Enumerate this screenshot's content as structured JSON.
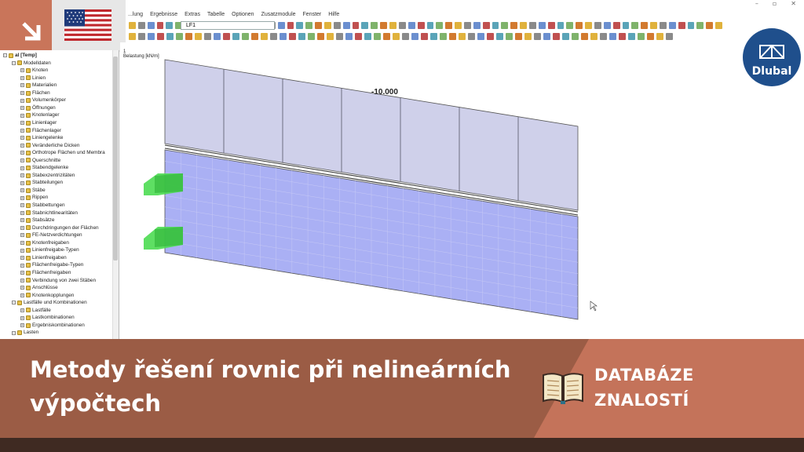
{
  "app": {
    "menu": [
      "...lung",
      "Ergebnisse",
      "Extras",
      "Tabelle",
      "Optionen",
      "Zusatzmodule",
      "Fenster",
      "Hilfe"
    ],
    "window_controls": [
      "–",
      "▫",
      "✕"
    ],
    "load_case": "LF1"
  },
  "navigator": {
    "items": [
      {
        "label": "al [Temp]",
        "level": 0,
        "bold": true
      },
      {
        "label": "Modelldaten",
        "level": 1
      },
      {
        "label": "Knoten",
        "level": 2
      },
      {
        "label": "Linien",
        "level": 2
      },
      {
        "label": "Materialien",
        "level": 2
      },
      {
        "label": "Flächen",
        "level": 2
      },
      {
        "label": "Volumenkörper",
        "level": 2
      },
      {
        "label": "Öffnungen",
        "level": 2
      },
      {
        "label": "Knotenlager",
        "level": 2
      },
      {
        "label": "Linienlager",
        "level": 2
      },
      {
        "label": "Flächenlager",
        "level": 2
      },
      {
        "label": "Liniengelenke",
        "level": 2
      },
      {
        "label": "Veränderliche Dicken",
        "level": 2
      },
      {
        "label": "Orthotrope Flächen und Membra",
        "level": 2
      },
      {
        "label": "Querschnitte",
        "level": 2
      },
      {
        "label": "Stabendgelenke",
        "level": 2
      },
      {
        "label": "Stabexzentrizitäten",
        "level": 2
      },
      {
        "label": "Stabteilungen",
        "level": 2
      },
      {
        "label": "Stäbe",
        "level": 2
      },
      {
        "label": "Rippen",
        "level": 2
      },
      {
        "label": "Stabbettungen",
        "level": 2
      },
      {
        "label": "Stabnichtlinearitäten",
        "level": 2
      },
      {
        "label": "Stabsätze",
        "level": 2
      },
      {
        "label": "Durchdringungen der Flächen",
        "level": 2
      },
      {
        "label": "FE-Netzverdichtungen",
        "level": 2
      },
      {
        "label": "Knotenfreigaben",
        "level": 2
      },
      {
        "label": "Linienfreigabe-Typen",
        "level": 2
      },
      {
        "label": "Linienfreigaben",
        "level": 2
      },
      {
        "label": "Flächenfreigabe-Typen",
        "level": 2
      },
      {
        "label": "Flächenfreigaben",
        "level": 2
      },
      {
        "label": "Verbindung von zwei Stäben",
        "level": 2
      },
      {
        "label": "Anschlüsse",
        "level": 2
      },
      {
        "label": "Knotenkopplungen",
        "level": 2
      },
      {
        "label": "Lastfälle und Kombinationen",
        "level": 1
      },
      {
        "label": "Lastfälle",
        "level": 2
      },
      {
        "label": "Lastkombinationen",
        "level": 2
      },
      {
        "label": "Ergebniskombinationen",
        "level": 2
      },
      {
        "label": "Lasten",
        "level": 1
      }
    ]
  },
  "viewport": {
    "label_line1": "1",
    "label_line2": "Belastung [kN/m]",
    "load_value": "-10.000"
  },
  "brand": {
    "logo_text": "Dlubal",
    "accent": "#1f4f8c"
  },
  "banner": {
    "title": "Metody řešení rovnic při nelineárních výpočtech",
    "kb_line1": "DATABÁZE",
    "kb_line2": "ZNALOSTÍ"
  },
  "colors": {
    "banner_dark": "#9b5c45",
    "banner_light": "#c4735a",
    "slab_fill": "#aab0f4",
    "load_fill": "#cfd0ea",
    "support_green": "#4ddc52"
  }
}
